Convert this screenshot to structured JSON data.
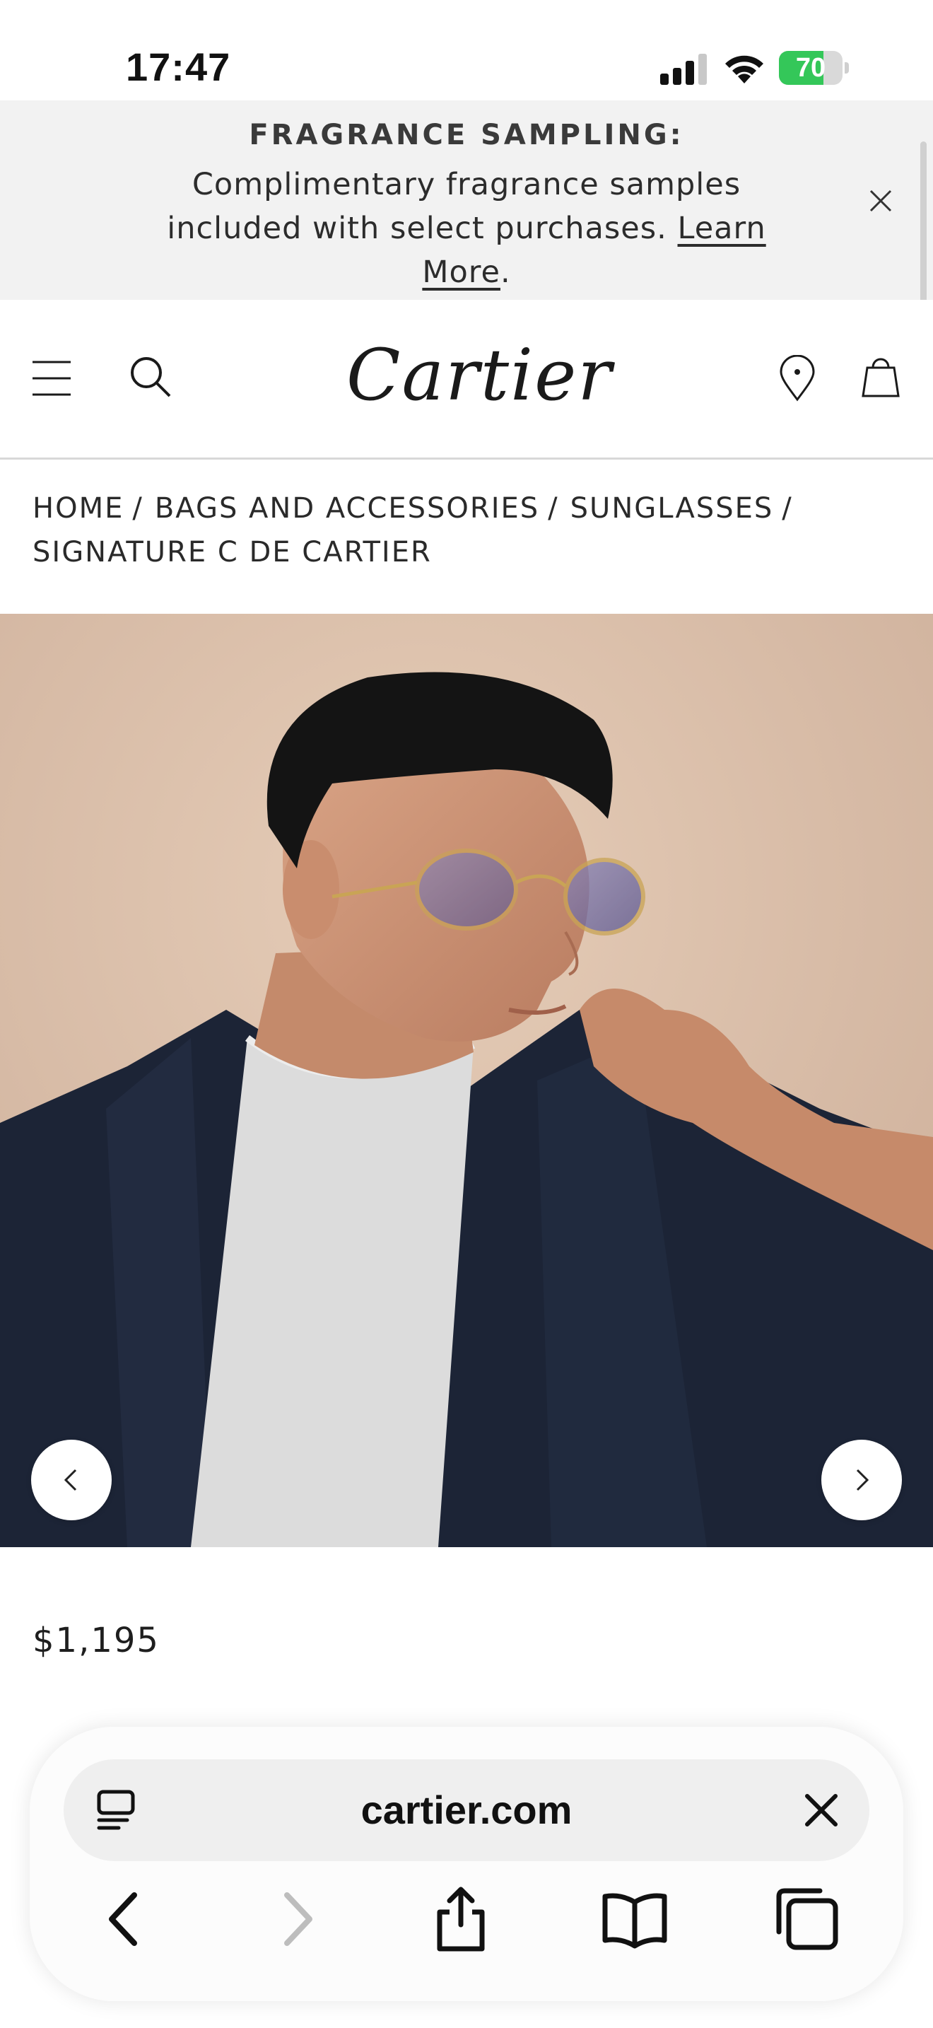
{
  "status_bar": {
    "time": "17:47",
    "battery_level": 70,
    "battery_text": "70"
  },
  "promo": {
    "title": "FRAGRANCE SAMPLING:",
    "text": "Complimentary fragrance samples included with select purchases. ",
    "link": "Learn More",
    "link_suffix": "."
  },
  "header": {
    "logo": "Cartier"
  },
  "breadcrumb": [
    {
      "label": "HOME"
    },
    {
      "label": "BAGS AND ACCESSORIES"
    },
    {
      "label": "SUNGLASSES"
    },
    {
      "label": "SIGNATURE C DE CARTIER"
    }
  ],
  "breadcrumb_separator": "/",
  "product": {
    "price": "$1,195"
  },
  "safari": {
    "url": "cartier.com"
  },
  "icons": {
    "menu": "menu-icon",
    "search": "search-icon",
    "location": "location-pin-icon",
    "bag": "shopping-bag-icon",
    "close": "close-icon",
    "prev": "chevron-left-icon",
    "next": "chevron-right-icon",
    "reader": "reader-icon",
    "back": "back-arrow-icon",
    "forward": "forward-arrow-icon",
    "share": "share-icon",
    "bookmarks": "bookmarks-icon",
    "tabs": "tabs-icon"
  },
  "colors": {
    "banner_bg": "#f2f2f2",
    "battery_green": "#34c759",
    "text": "#1e1e1e"
  }
}
